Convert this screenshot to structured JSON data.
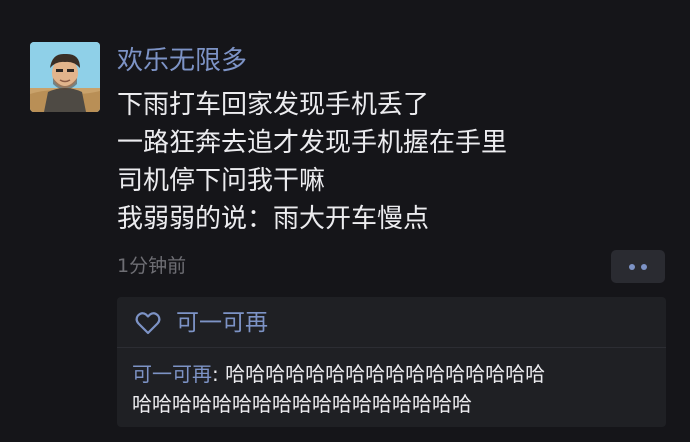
{
  "post": {
    "author": "欢乐无限多",
    "avatar_icon": "user-avatar-icon",
    "lines": [
      "下雨打车回家发现手机丢了",
      "一路狂奔去追才发现手机握在手里",
      "司机停下问我干嘛",
      "我弱弱的说：雨大开车慢点"
    ],
    "timestamp": "1分钟前",
    "more_icon": "more-dots-icon"
  },
  "interactions": {
    "like_icon": "heart-icon",
    "liker": "可一可再",
    "comments": [
      {
        "commenter": "可一可再",
        "separator": ":",
        "text_line1": " 哈哈哈哈哈哈哈哈哈哈哈哈哈哈哈哈",
        "text_line2": "哈哈哈哈哈哈哈哈哈哈哈哈哈哈哈哈哈"
      }
    ]
  },
  "colors": {
    "background": "#151519",
    "name_link": "#7d93c6",
    "text": "#ececef",
    "muted": "#6e6e74",
    "panel": "#1f2024"
  }
}
